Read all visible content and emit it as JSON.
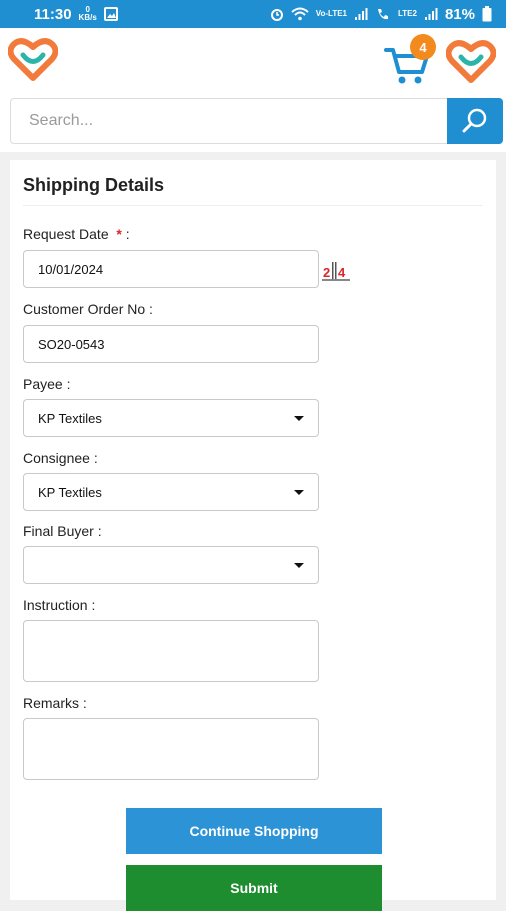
{
  "status_bar": {
    "time": "11:30",
    "data_rate_value": "0",
    "data_rate_unit": "KB/s",
    "battery": "81%",
    "network_1": "Vo‑LTE1",
    "network_2": "LTE2"
  },
  "header": {
    "cart_count": "4"
  },
  "search": {
    "placeholder": "Search..."
  },
  "form": {
    "title": "Shipping Details",
    "request_date_label": "Request Date",
    "required_mark": "*",
    "request_date_colon": ":",
    "request_date_value": "10/01/2024",
    "customer_order_label": "Customer Order No   :",
    "customer_order_value": "SO20-0543",
    "payee_label": "Payee   :",
    "payee_value": "KP Textiles",
    "consignee_label": "Consignee   :",
    "consignee_value": "KP Textiles",
    "final_buyer_label": "Final Buyer   :",
    "final_buyer_value": "",
    "instruction_label": "Instruction   :",
    "instruction_value": "",
    "remarks_label": "Remarks   :",
    "remarks_value": ""
  },
  "buttons": {
    "continue_label": "Continue Shopping",
    "submit_label": "Submit"
  },
  "colors": {
    "primary": "#1f8fd1",
    "submit": "#1e8d2f",
    "badge": "#f28a1e",
    "logo_orange": "#f27a3a",
    "logo_teal": "#2bb5a8"
  }
}
